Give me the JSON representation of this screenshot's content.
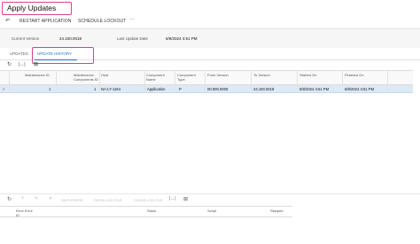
{
  "page": {
    "title": "Apply Updates"
  },
  "toolbar": {
    "undo_icon": "undo-icon",
    "restart_label": "RESTART APPLICATION",
    "schedule_label": "SCHEDULE LOCKOUT",
    "more_label": "···"
  },
  "summary": {
    "current_version_label": "Current Version",
    "current_version_value": "24.100.0018",
    "last_update_label": "Last Update Date",
    "last_update_value": "6/8/2024 4:51 PM"
  },
  "tabs": [
    {
      "label": "UPDATES"
    },
    {
      "label": "UPDATE HISTORY"
    }
  ],
  "grid_toolbar": {
    "refresh_icon": "↻",
    "fit_icon": "|↔|",
    "export_icon": "⊠"
  },
  "grid": {
    "columns": [
      "Maintenance ID",
      "Maintenance Components ID",
      "Host",
      "Component Name",
      "Component Type",
      "From Version",
      "To Version",
      "Started On",
      "Finished On"
    ],
    "rows": [
      {
        "indicator": ">",
        "maintenance_id": "1",
        "components_id": "1",
        "host": "NA-LT-1164",
        "component_name": "Application",
        "component_type": "P",
        "from_version": "00.000.0000",
        "to_version": "24.100.0018",
        "started_on": "6/8/2024 4:51 PM",
        "finished_on": "6/8/2024 4:51 PM"
      }
    ]
  },
  "lower_toolbar": {
    "refresh_icon": "↻",
    "add_icon": "+",
    "edit_icon": "✎",
    "delete_icon": "✕",
    "skip_error": "SKIP ERROR",
    "show_log": "SHOW LOG FILE",
    "clear_log": "CLEAR LOG FILE",
    "fit_icon": "|↔|",
    "export_icon": "⊠"
  },
  "lower_grid": {
    "columns": [
      "Error ID",
      "Error",
      "Stack",
      "Script",
      "Skipped"
    ]
  }
}
